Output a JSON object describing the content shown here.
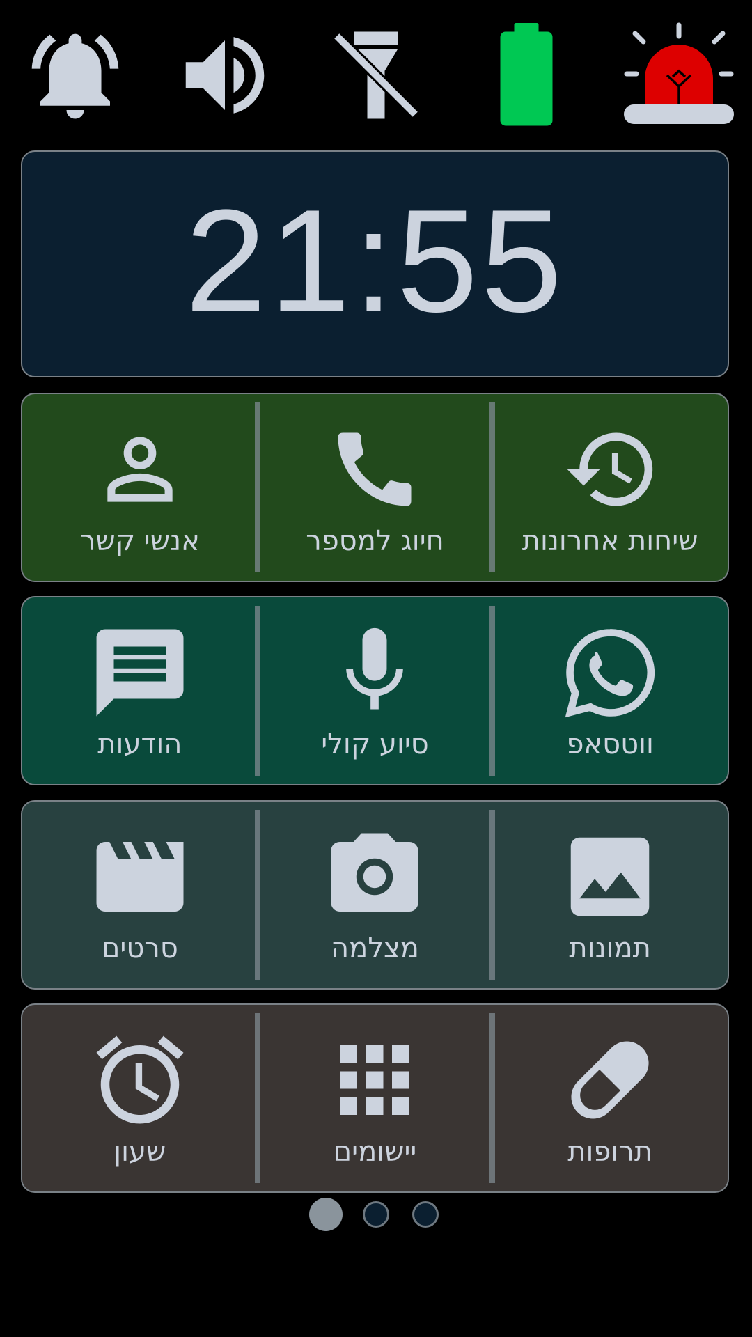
{
  "status_icons": [
    "bell-icon",
    "speaker-icon",
    "flashlight-off-icon",
    "battery-icon",
    "emergency-siren-icon"
  ],
  "colors": {
    "battery": "#00c853",
    "siren": "#dd0000",
    "icon": "#ccd3de"
  },
  "clock": {
    "time": "21:55"
  },
  "rows": [
    [
      {
        "label": "שיחות אחרונות",
        "icon": "history-icon"
      },
      {
        "label": "חיוג למספר",
        "icon": "phone-icon"
      },
      {
        "label": "אנשי קשר",
        "icon": "contact-icon"
      }
    ],
    [
      {
        "label": "ווטסאפ",
        "icon": "whatsapp-icon"
      },
      {
        "label": "סיוע קולי",
        "icon": "microphone-icon"
      },
      {
        "label": "הודעות",
        "icon": "message-icon"
      }
    ],
    [
      {
        "label": "תמונות",
        "icon": "image-icon"
      },
      {
        "label": "מצלמה",
        "icon": "camera-icon"
      },
      {
        "label": "סרטים",
        "icon": "clapperboard-icon"
      }
    ],
    [
      {
        "label": "תרופות",
        "icon": "pill-icon"
      },
      {
        "label": "יישומים",
        "icon": "apps-grid-icon"
      },
      {
        "label": "שעון",
        "icon": "alarm-clock-icon"
      }
    ]
  ],
  "pager": {
    "pages": 3,
    "current": 1
  }
}
